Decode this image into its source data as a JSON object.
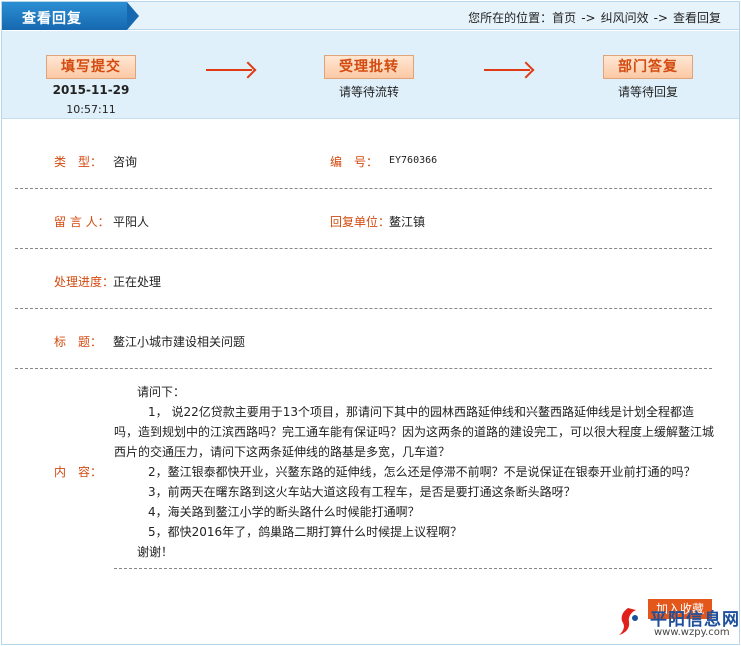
{
  "header": {
    "title": "查看回复",
    "breadcrumb": {
      "prefix": "您所在的位置：",
      "items": [
        "首页",
        "纠风问效",
        "查看回复"
      ],
      "separator": "->"
    }
  },
  "steps": [
    {
      "label": "填写提交",
      "sub1": "2015-11-29",
      "sub2": "10:57:11"
    },
    {
      "label": "受理批转",
      "sub1": "请等待流转"
    },
    {
      "label": "部门答复",
      "sub1": "请等待回复"
    }
  ],
  "details": {
    "type_label": "类　型：",
    "type_value": "咨询",
    "number_label": "编　号：",
    "number_value": "EY760366",
    "author_label": "留 言 人：",
    "author_value": "平阳人",
    "unit_label": "回复单位：",
    "unit_value": "鳌江镇",
    "progress_label": "处理进度：",
    "progress_value": "正在处理",
    "title_label": "标　题：",
    "title_value": "鳌江小城市建设相关问题",
    "content_label": "内　容：",
    "content": {
      "greeting": "请问下：",
      "items": [
        "1，  说22亿贷款主要用于13个项目，那请问下其中的园林西路延伸线和兴鳌西路延伸线是计划全程都造吗，造到规划中的江滨西路吗？完工通车能有保证吗？因为这两条的道路的建设完工，可以很大程度上缓解鳌江城西片的交通压力，请问下这两条延伸线的路基是多宽，几车道？",
        "2，鳌江银泰都快开业，兴鳌东路的延伸线，怎么还是停滞不前啊？不是说保证在银泰开业前打通的吗？",
        "3，前两天在曙东路到这火车站大道这段有工程车，是否是要打通这条断头路呀？",
        "4，海关路到鳌江小学的断头路什么时候能打通啊？",
        "5，都快2016年了，鸽巢路二期打算什么时候提上议程啊？"
      ],
      "closing": "谢谢！"
    }
  },
  "actions": {
    "favorite_label": "加入收藏"
  },
  "watermark": {
    "title": "平阳信息网",
    "url": "www.wzpy.com"
  },
  "colors": {
    "accent": "#d34b10",
    "header_blue": "#1668b0",
    "strip_bg": "#dff0fa",
    "arrow": "#e03a15"
  }
}
